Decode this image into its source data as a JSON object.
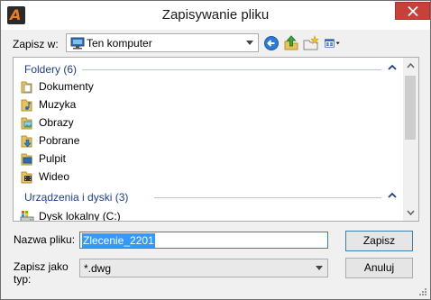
{
  "window": {
    "title": "Zapisywanie pliku"
  },
  "save_in": {
    "label": "Zapisz w:",
    "value": "Ten komputer"
  },
  "groups": [
    {
      "title": "Foldery (6)",
      "items": [
        {
          "label": "Dokumenty",
          "icon": "documents-folder-icon"
        },
        {
          "label": "Muzyka",
          "icon": "music-folder-icon"
        },
        {
          "label": "Obrazy",
          "icon": "pictures-folder-icon"
        },
        {
          "label": "Pobrane",
          "icon": "downloads-folder-icon"
        },
        {
          "label": "Pulpit",
          "icon": "desktop-folder-icon"
        },
        {
          "label": "Wideo",
          "icon": "videos-folder-icon"
        }
      ]
    },
    {
      "title": "Urządzenia i dyski (3)",
      "items": [
        {
          "label": "Dysk lokalny (C:)",
          "icon": "local-disk-icon"
        }
      ]
    }
  ],
  "filename": {
    "label": "Nazwa pliku:",
    "value": "Zlecenie_2201"
  },
  "filetype": {
    "label_line1": "Zapisz jako",
    "label_line2": "typ:",
    "value": "*.dwg"
  },
  "buttons": {
    "save": "Zapisz",
    "cancel": "Anuluj"
  },
  "colors": {
    "close": "#c7413a",
    "group_header": "#1e3d8f",
    "selection": "#3399ff"
  }
}
